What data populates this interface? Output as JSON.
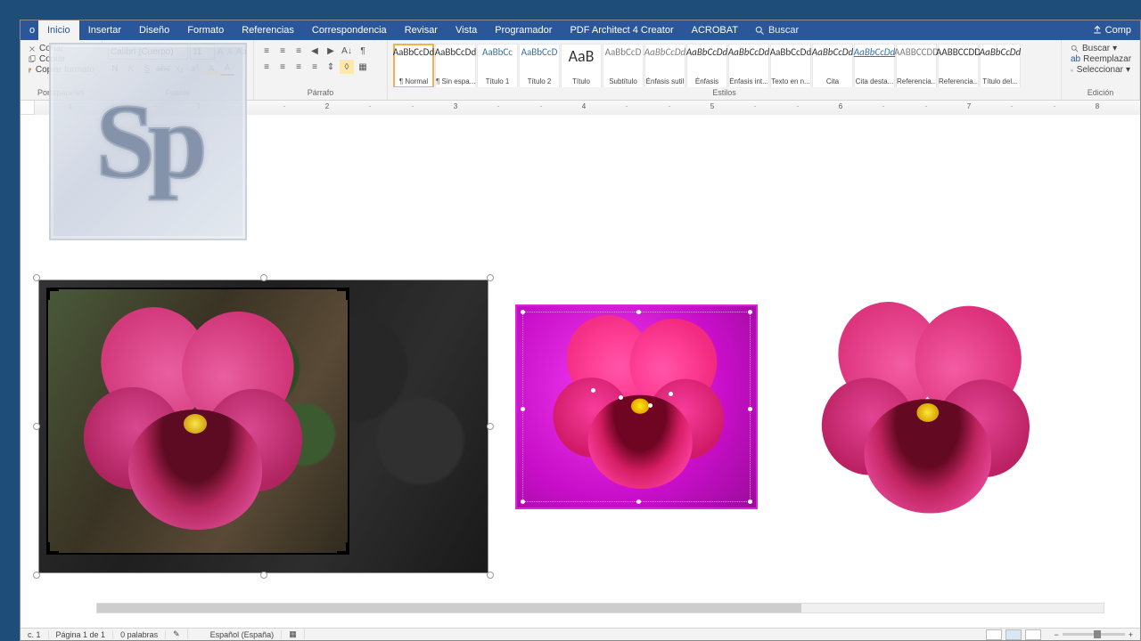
{
  "menubar": {
    "tabs": [
      "Inicio",
      "Insertar",
      "Diseño",
      "Formato",
      "Referencias",
      "Correspondencia",
      "Revisar",
      "Vista",
      "Programador",
      "PDF Architect 4 Creator",
      "ACROBAT"
    ],
    "activeIndex": 0,
    "tellme": "Buscar",
    "share": "Comp"
  },
  "ribbon": {
    "clipboard": {
      "cut": "Cortar",
      "copy": "Copiar",
      "paint": "Copiar formato",
      "label": "Portapapeles"
    },
    "font": {
      "family": "Calibri (Cuerpo)",
      "size": "11",
      "label": "Fuente"
    },
    "para": {
      "label": "Párrafo"
    },
    "styles": {
      "label": "Estilos",
      "items": [
        {
          "prev": "AaBbCcDd",
          "name": "¶ Normal",
          "cls": "",
          "sel": true
        },
        {
          "prev": "AaBbCcDd",
          "name": "¶ Sin espa...",
          "cls": ""
        },
        {
          "prev": "AaBbCc",
          "name": "Título 1",
          "cls": "blue"
        },
        {
          "prev": "AaBbCcD",
          "name": "Título 2",
          "cls": "blue"
        },
        {
          "prev": "AaB",
          "name": "Título",
          "cls": "big"
        },
        {
          "prev": "AaBbCcD",
          "name": "Subtítulo",
          "cls": "grey"
        },
        {
          "prev": "AaBbCcDd",
          "name": "Énfasis sutil",
          "cls": "grey it"
        },
        {
          "prev": "AaBbCcDd",
          "name": "Énfasis",
          "cls": "it"
        },
        {
          "prev": "AaBbCcDd",
          "name": "Énfasis int...",
          "cls": "it"
        },
        {
          "prev": "AaBbCcDd",
          "name": "Texto en n...",
          "cls": ""
        },
        {
          "prev": "AaBbCcDd",
          "name": "Cita",
          "cls": "it"
        },
        {
          "prev": "AaBbCcDd",
          "name": "Cita desta...",
          "cls": "blue it ul"
        },
        {
          "prev": "AABBCCDD",
          "name": "Referencia...",
          "cls": "grey"
        },
        {
          "prev": "AABBCCDD",
          "name": "Referencia...",
          "cls": ""
        },
        {
          "prev": "AaBbCcDd",
          "name": "Título del...",
          "cls": "it"
        }
      ]
    },
    "edit": {
      "find": "Buscar",
      "replace": "Reemplazar",
      "select": "Seleccionar",
      "label": "Edición"
    }
  },
  "ruler": {
    "marks": [
      "1",
      "·",
      "·",
      "1",
      "·",
      "·",
      "2",
      "·",
      "·",
      "3",
      "·",
      "·",
      "4",
      "·",
      "·",
      "5",
      "·",
      "·",
      "6",
      "·",
      "·",
      "7",
      "·",
      "·",
      "8"
    ]
  },
  "status": {
    "sec": "c. 1",
    "page": "Página 1 de 1",
    "words": "0 palabras",
    "lang": "Español (España)",
    "zoom": "+"
  },
  "logo": "Sp"
}
